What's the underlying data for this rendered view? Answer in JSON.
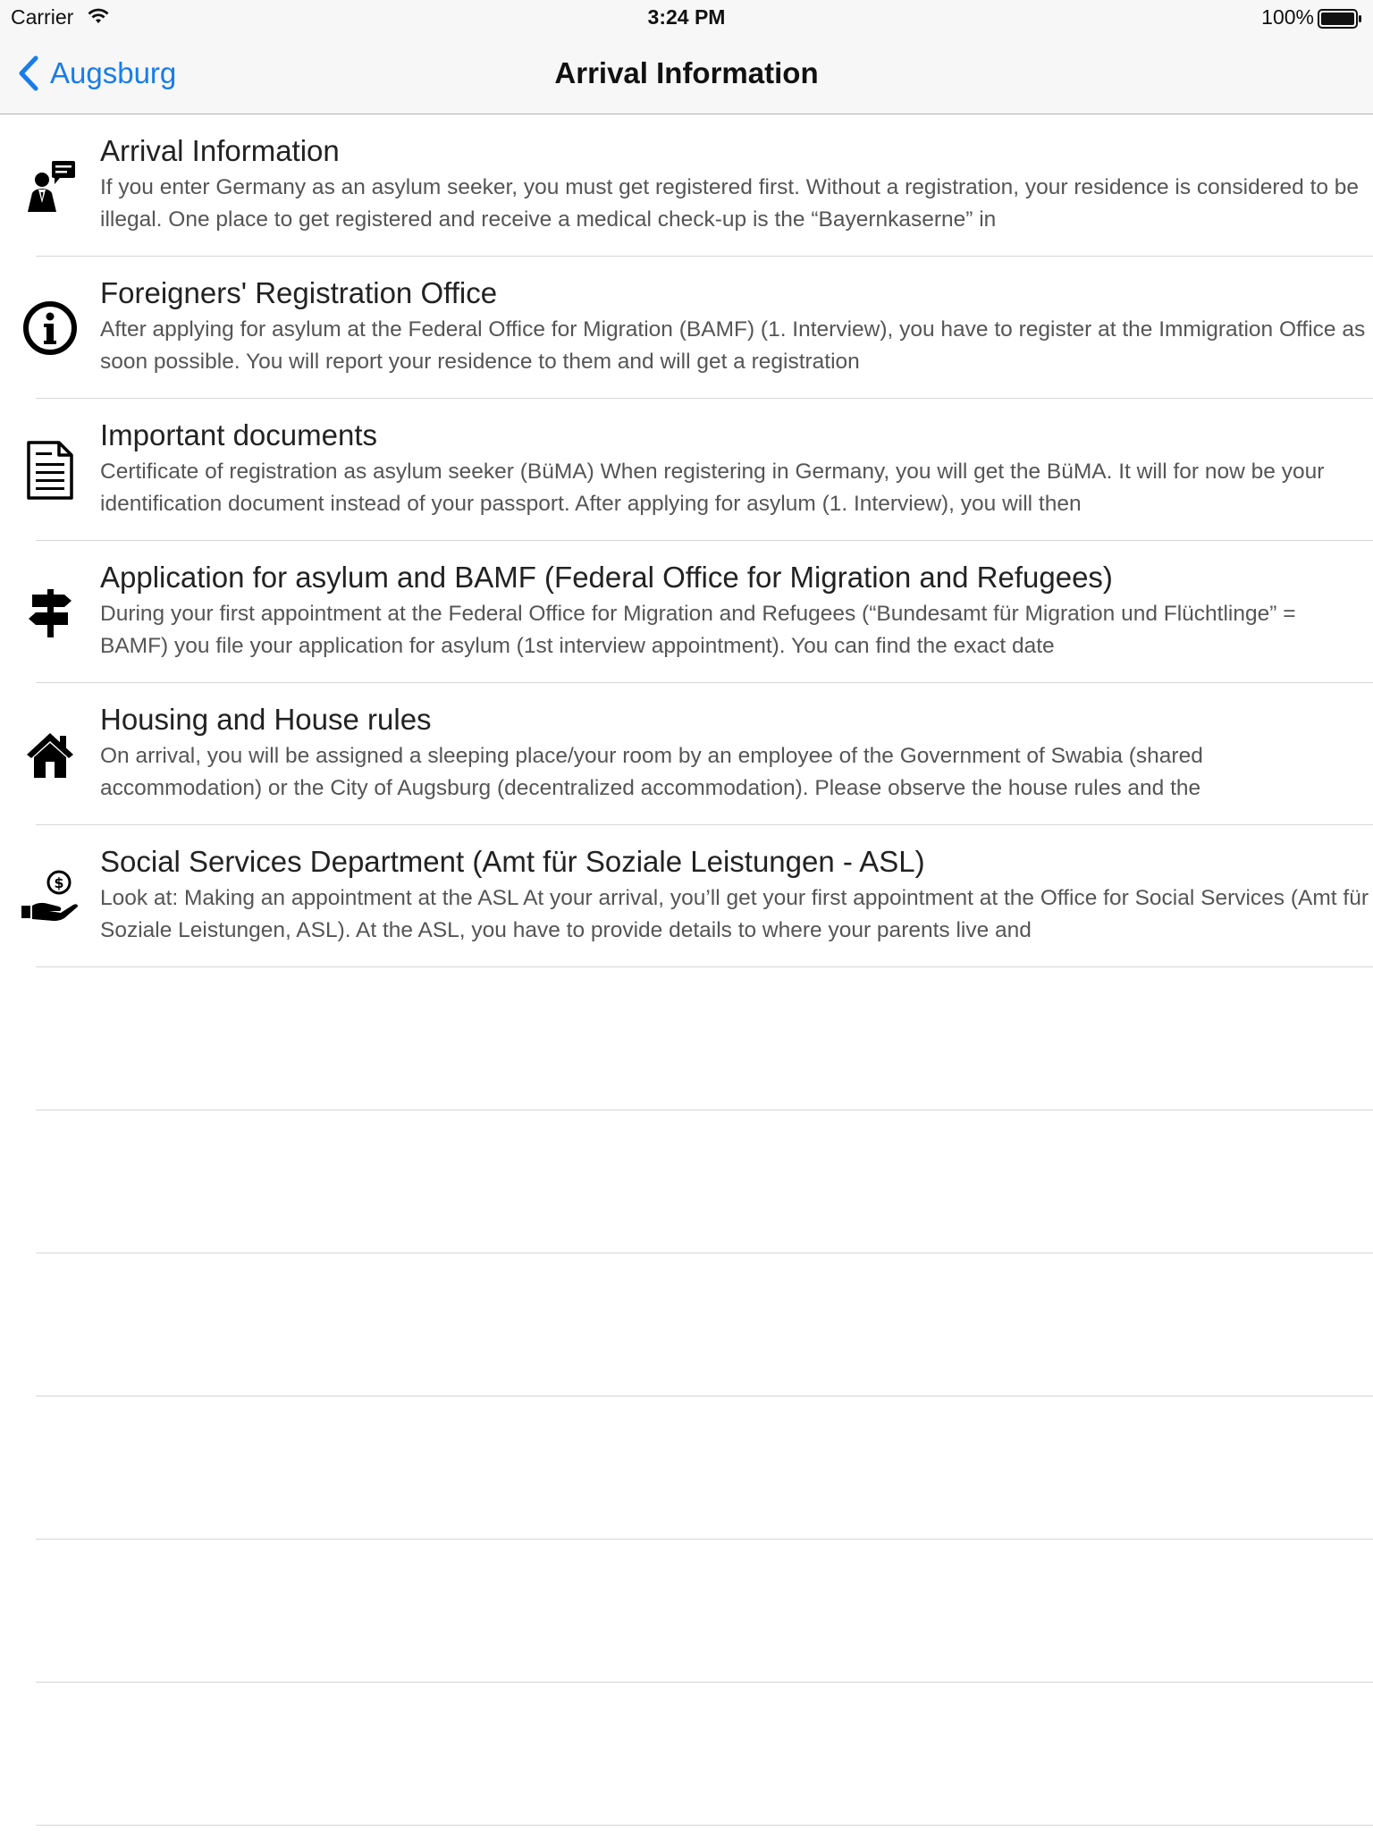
{
  "status_bar": {
    "carrier": "Carrier",
    "time": "3:24 PM",
    "battery": "100%"
  },
  "nav": {
    "back_label": "Augsburg",
    "title": "Arrival Information"
  },
  "items": [
    {
      "icon": "person-speech-icon",
      "title": "Arrival Information",
      "description": "If you enter Germany as an asylum seeker, you must get registered first. Without a registration, your residence is considered to be illegal. One place to get registered and receive a medical check-up is the “Bayernkaserne” in"
    },
    {
      "icon": "info-icon",
      "title": "Foreigners' Registration Office",
      "description": "After applying for asylum at the Federal Office for Migration (BAMF) (1. Interview), you have to register at the Immigration Office as soon possible. You will report your residence to them and will get a registration"
    },
    {
      "icon": "document-icon",
      "title": "Important documents",
      "description": "Certificate of registration as asylum seeker (BüMA) When registering in Germany, you will get the BüMA. It will for now be your identification document instead of your passport. After applying for asylum (1. Interview), you will then"
    },
    {
      "icon": "signpost-icon",
      "title": "Application for asylum and BAMF (Federal Office for Migration and Refugees)",
      "description": "During your first appointment at the Federal Office for Migration and Refugees (“Bundesamt für Migration und Flüchtlinge” = BAMF) you file your application for asylum (1st interview appointment). You can find the exact date"
    },
    {
      "icon": "house-icon",
      "title": "Housing and House rules",
      "description": "On arrival, you will be assigned a sleeping place/your room by an employee of the Government of Swabia (shared accommodation) or the City of Augsburg (decentralized accommodation). Please observe the house rules and the"
    },
    {
      "icon": "hand-money-icon",
      "title": "Social Services Department (Amt für Soziale Leistungen - ASL)",
      "description": "Look at: Making an appointment at the ASL  At your arrival, you’ll get your first appointment at the Office for Social Services (Amt für Soziale Leistungen, ASL). At the ASL, you have to provide details to where your parents live and"
    }
  ],
  "colors": {
    "accent": "#1a7ce8",
    "separator": "#d7d7da",
    "bar_background": "#f7f7f7"
  }
}
